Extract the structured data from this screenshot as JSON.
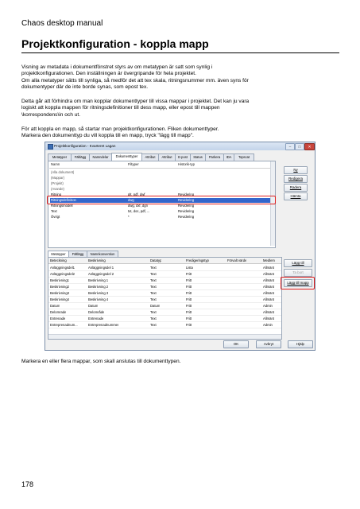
{
  "header": {
    "running_title": "Chaos desktop manual"
  },
  "heading": "Projektkonfiguration - koppla mapp",
  "paragraphs": [
    "Visning av metadata i dokumentfönstret styrs av om metatypen är satt som synlig i\nprojektkonfigurationen. Den inställningen är övergripande för hela projektet.\nOm alla metatyper sätts till synliga, så medför det att tex skala, ritningsnummer mm. även syns för\ndokumentyper där de inte borde synas, som epost tex.",
    "Detta går att förhindra om man kopplar dokumenttyper till vissa mappar i projektet. Det kan ju vara\nlogiskt att koppla mappen för ritningsdefinitioner till dess mapp, eller epost till mappen\n\\korrespondens\\in och ut.",
    "För att koppla en mapp, så startar man projektkonfigurationen. Fliken dokumenttyper.\nMarkera den dokumenttyp du vill koppla till en mapp, tryck \"lägg till mapp\".",
    "Markera en eller flera mappar, som skall anslutas till dokumenttypen."
  ],
  "page_number": "178",
  "dialog": {
    "title": "Projektkonfiguration - Kvarteret Lagan",
    "tabs": [
      "Metatyper",
      "Fältlägg",
      "Namndelar",
      "Dokumenttyper",
      "Attribut",
      "Attribut",
      "E-post",
      "Status",
      "Parkera",
      "IDA",
      "Topscat"
    ],
    "active_tab_index": 3,
    "list_headers": [
      "Namn",
      "Filtyper",
      "Historik-typ"
    ],
    "list_rows": [
      {
        "namn": "(Alla dokument)",
        "filtyper": "",
        "historik": ""
      },
      {
        "namn": "(Mappar)",
        "filtyper": "",
        "historik": ""
      },
      {
        "namn": "(Projekt)",
        "filtyper": "",
        "historik": ""
      },
      {
        "namn": "(Avande)",
        "filtyper": "",
        "historik": ""
      },
      {
        "namn": "Ritning",
        "filtyper": "plt, pdf, dwf",
        "historik": "Revidering"
      },
      {
        "namn": "Ritningsdefinition",
        "filtyper": "dwg",
        "historik": "Revidering"
      },
      {
        "namn": "Ritningsmodell",
        "filtyper": "dwg, dxf, dgn",
        "historik": "Revidering"
      },
      {
        "namn": "Text",
        "filtyper": "txt, doc, pdf, ...",
        "historik": "Revidering"
      },
      {
        "namn": "Övrigt",
        "filtyper": "*",
        "historik": "Revidering"
      }
    ],
    "selected_row_index": 5,
    "side_buttons": [
      "Ny",
      "Redigera",
      "Radera",
      "Hämta"
    ],
    "lower_tabs": [
      "Metatyper",
      "Fältlägg",
      "Namnkonvention"
    ],
    "grid_headers": [
      "Beteckning",
      "Beskrivning",
      "Datatyp",
      "Fredigeringstyp",
      "Förvalt värde",
      "Medlem"
    ],
    "grid_rows": [
      [
        "Anläggningsdel1",
        "Anläggningsdel 1",
        "Text",
        "Lista",
        "",
        "Allmänt"
      ],
      [
        "Anläggningsdel2",
        "Anläggningsdel 2",
        "Text",
        "Fritt",
        "",
        "Allmänt"
      ],
      [
        "Beskrivning1",
        "Beskrivning 1",
        "Text",
        "Fritt",
        "",
        "Allmänt"
      ],
      [
        "Beskrivning2",
        "Beskrivning 2",
        "Text",
        "Fritt",
        "",
        "Allmänt"
      ],
      [
        "Beskrivning3",
        "Beskrivning 3",
        "Text",
        "Fritt",
        "",
        "Allmänt"
      ],
      [
        "Beskrivning4",
        "Beskrivning 4",
        "Text",
        "Fritt",
        "",
        "Allmänt"
      ],
      [
        "Datum",
        "Datum",
        "Datum",
        "Fritt",
        "",
        "Admin"
      ],
      [
        "Delomrade",
        "Delområde",
        "Text",
        "Fritt",
        "",
        "Allmänt"
      ],
      [
        "Entrenade",
        "Entrenade",
        "Text",
        "Fritt",
        "",
        "Allmänt"
      ],
      [
        "Entreprenadnum...",
        "Entreprenadnummer",
        "Text",
        "Fritt",
        "",
        "Admin"
      ]
    ],
    "right_buttons": [
      "Lägg till",
      "Ta bort",
      "Lägg till mapp"
    ],
    "bottom_buttons": [
      "OK",
      "Avbryt",
      "Hjälp"
    ]
  }
}
